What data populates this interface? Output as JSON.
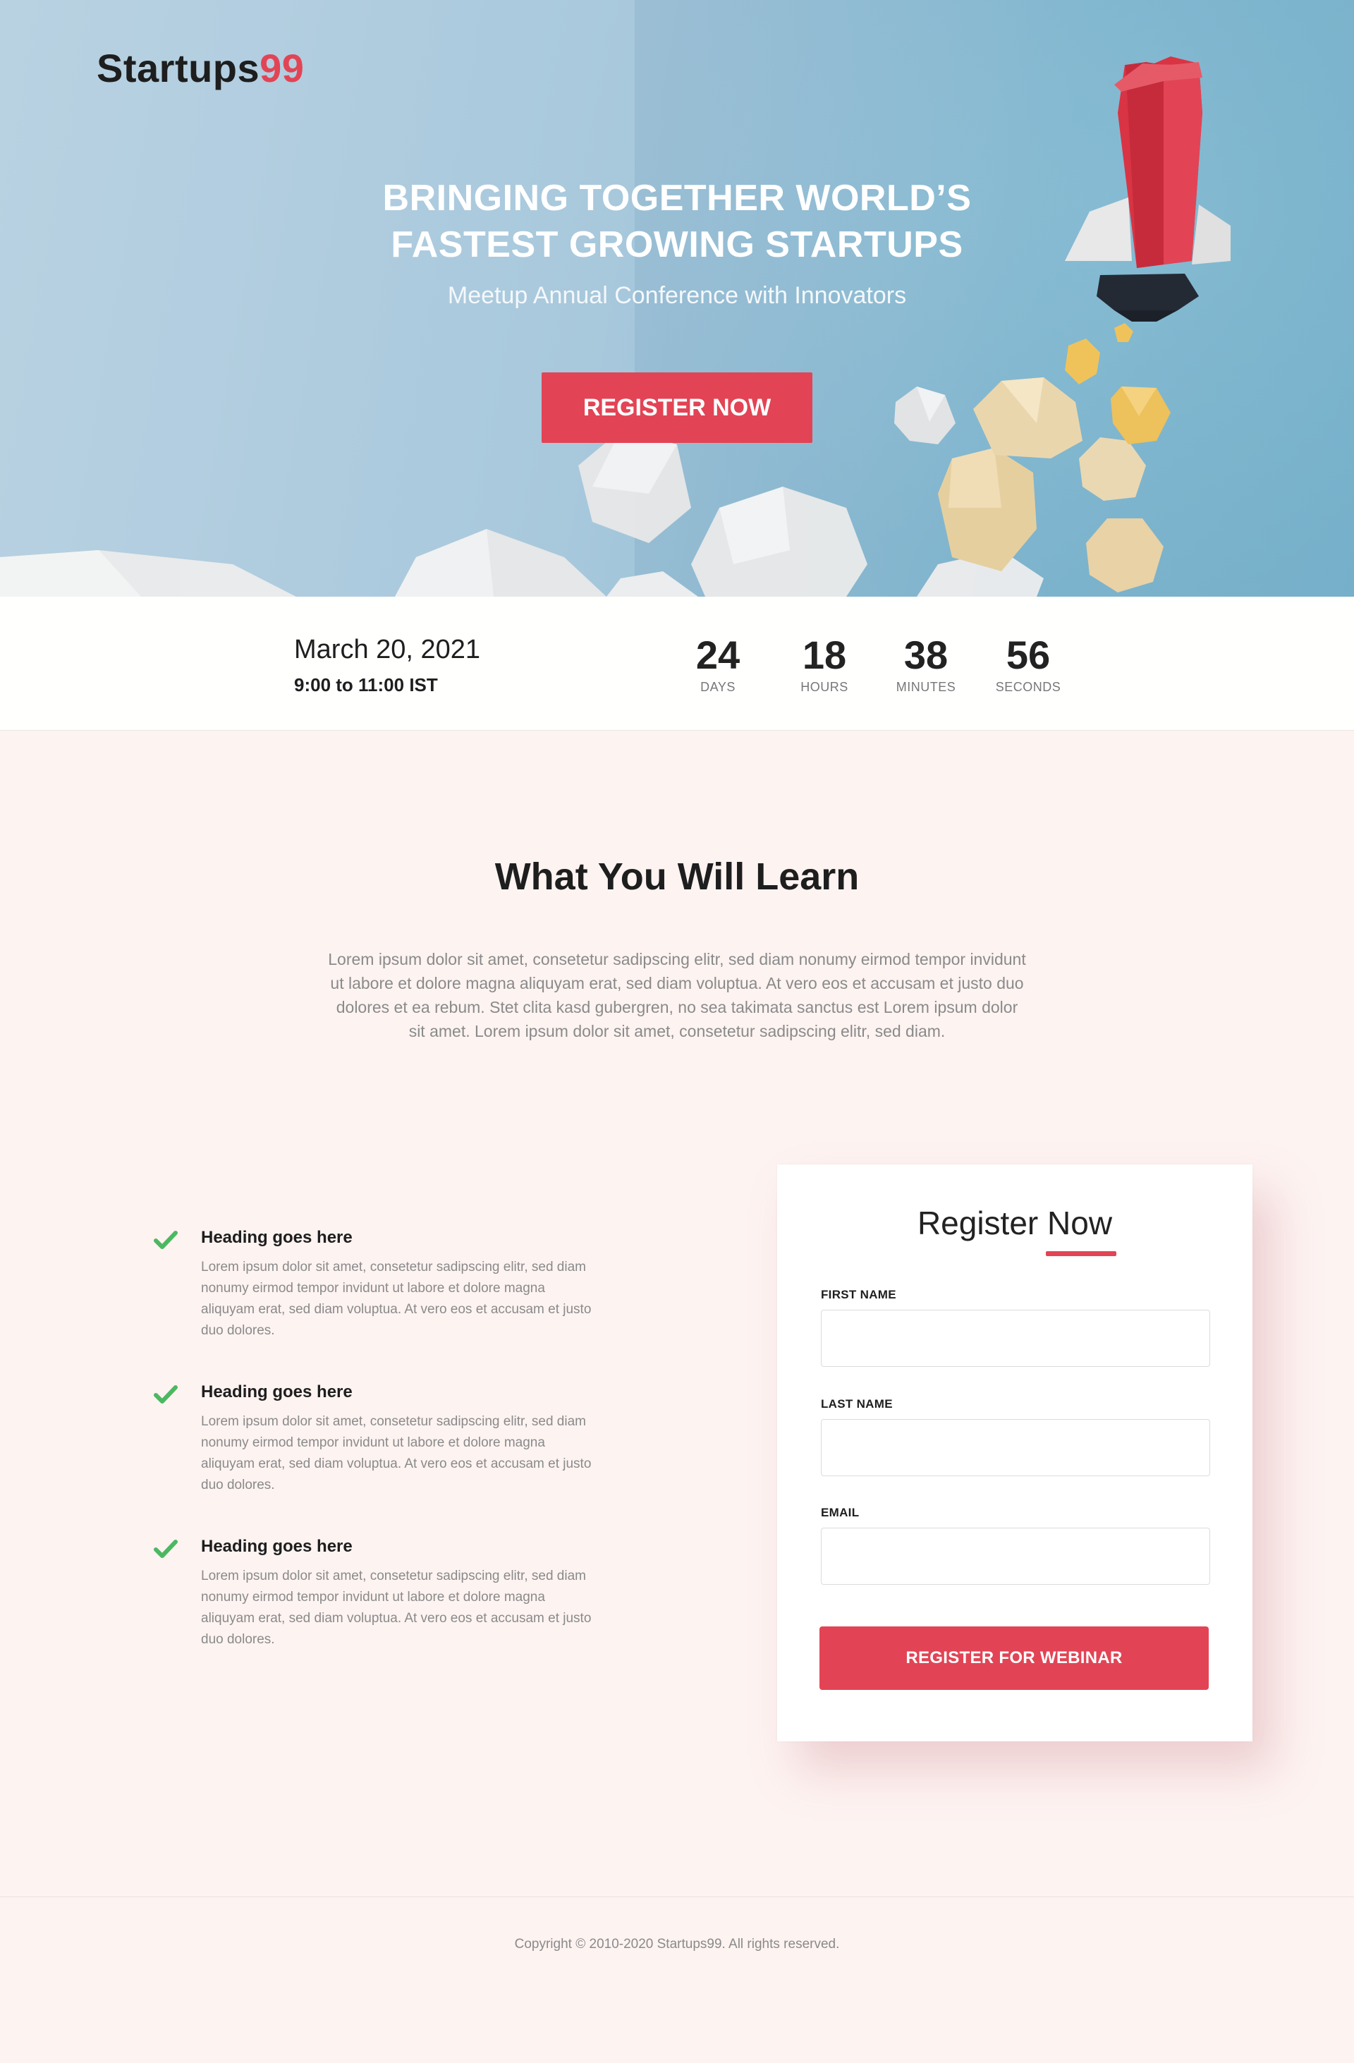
{
  "brand": {
    "name": "Startups",
    "number": "99"
  },
  "hero": {
    "title_line1": "BRINGING TOGETHER WORLD’S",
    "title_line2": "FASTEST GROWING STARTUPS",
    "subtitle": "Meetup Annual Conference with Innovators",
    "cta_label": "REGISTER NOW"
  },
  "event": {
    "date": "March 20, 2021",
    "time": "9:00 to 11:00 IST",
    "countdown": [
      {
        "value": "24",
        "unit": "DAYS"
      },
      {
        "value": "18",
        "unit": "HOURS"
      },
      {
        "value": "38",
        "unit": "MINUTES"
      },
      {
        "value": "56",
        "unit": "SECONDS"
      }
    ]
  },
  "learn": {
    "title": "What You Will Learn",
    "text": "Lorem ipsum dolor sit amet, consetetur sadipscing elitr, sed diam nonumy eirmod tempor invidunt ut labore et dolore magna aliquyam erat, sed diam voluptua. At vero eos et accusam et justo duo dolores et ea rebum. Stet clita kasd gubergren, no sea takimata sanctus est Lorem ipsum dolor sit amet. Lorem ipsum dolor sit amet, consetetur sadipscing elitr, sed diam.",
    "features": [
      {
        "heading": "Heading goes here",
        "text": "Lorem ipsum dolor sit amet, consetetur sadipscing elitr, sed diam nonumy eirmod tempor invidunt ut labore et dolore magna aliquyam erat, sed diam voluptua. At vero eos et accusam et justo duo dolores."
      },
      {
        "heading": "Heading goes here",
        "text": "Lorem ipsum dolor sit amet, consetetur sadipscing elitr, sed diam nonumy eirmod tempor invidunt ut labore et dolore magna aliquyam erat, sed diam voluptua. At vero eos et accusam et justo duo dolores."
      },
      {
        "heading": "Heading goes here",
        "text": "Lorem ipsum dolor sit amet, consetetur sadipscing elitr, sed diam nonumy eirmod tempor invidunt ut labore et dolore magna aliquyam erat, sed diam voluptua. At vero eos et accusam et justo duo dolores."
      }
    ]
  },
  "form": {
    "title": "Register Now",
    "first_name_label": "FIRST NAME",
    "first_name_value": "",
    "last_name_label": "LAST NAME",
    "last_name_value": "",
    "email_label": "EMAIL",
    "email_value": "",
    "submit_label": "REGISTER FOR WEBINAR"
  },
  "footer": {
    "copyright": "Copyright ©  2010-2020 Startups99. All rights reserved."
  },
  "colors": {
    "accent": "#e24455",
    "check": "#4cb861",
    "hero_sky": "#a8c8dc",
    "page_bg": "#fdf3f1"
  },
  "icons": {
    "feature_icon": "checkmark-icon",
    "hero_art": "rocket-illustration"
  }
}
